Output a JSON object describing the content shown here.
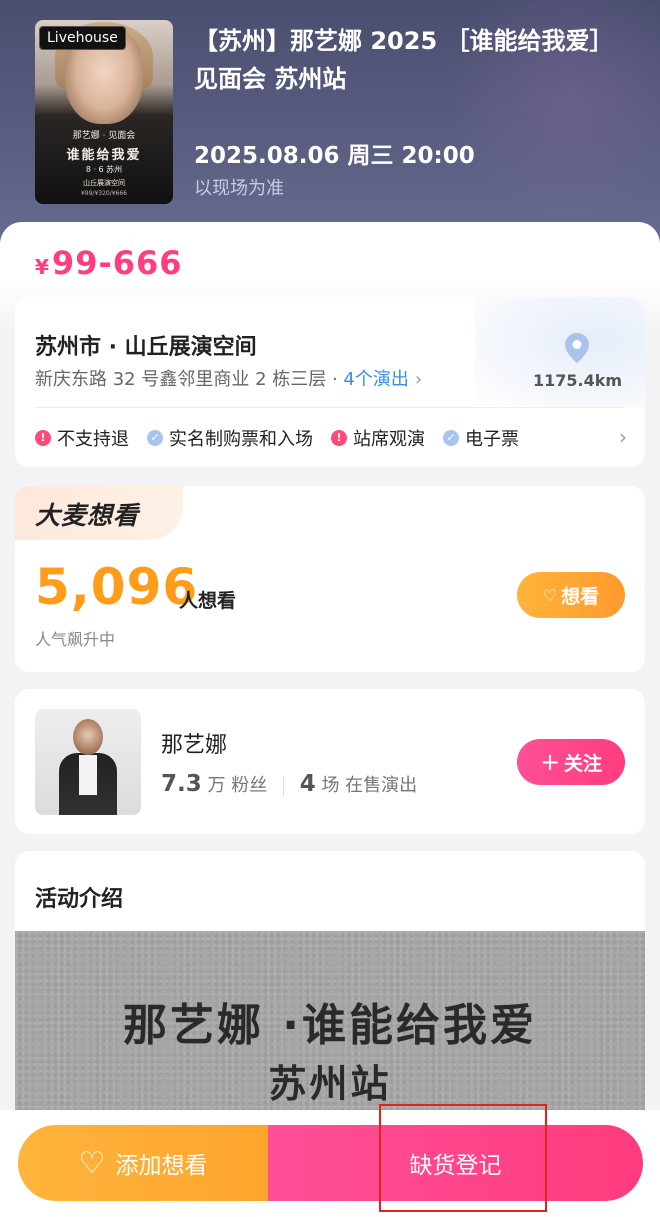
{
  "header": {
    "poster": {
      "tag": "Livehouse",
      "lines": [
        "那艺娜 · 见面会",
        "谁能给我爱",
        "8 · 6 苏州",
        "山丘展演空间",
        "¥99/¥320/¥666"
      ]
    },
    "title": "【苏州】那艺娜 2025 ［谁能给我爱］见面会 苏州站",
    "datetime": "2025.08.06 周三 20:00",
    "date_note": "以现场为准"
  },
  "price": {
    "currency": "¥",
    "range": "99-666"
  },
  "venue": {
    "name": "苏州市 · 山丘展演空间",
    "address": "新庆东路 32 号鑫邻里商业 2 栋三层 ·",
    "shows_link": "4个演出",
    "distance": "1175.4km",
    "tags": [
      {
        "icon": "warn",
        "label": "不支持退"
      },
      {
        "icon": "ok",
        "label": "实名制购票和入场"
      },
      {
        "icon": "warn",
        "label": "站席观演"
      },
      {
        "icon": "ok",
        "label": "电子票"
      }
    ]
  },
  "want": {
    "badge": "大麦想看",
    "count": "5,096",
    "unit": "人想看",
    "sub": "人气飙升中",
    "button": "想看"
  },
  "artist": {
    "name": "那艺娜",
    "fans_num": "7.3",
    "fans_unit": "万 粉丝",
    "shows_num": "4",
    "shows_unit": "场 在售演出",
    "follow": "关注"
  },
  "intro": {
    "title": "活动介绍",
    "banner_line1": "那艺娜 ·谁能给我爱",
    "banner_line2": "苏州站"
  },
  "bottom": {
    "add_want": "添加想看",
    "register": "缺货登记"
  },
  "colors": {
    "accent_pink": "#ff3d7f",
    "accent_orange": "#ff9c1a",
    "link_blue": "#3a8ee6",
    "header_bg": "#4a4e6e"
  }
}
